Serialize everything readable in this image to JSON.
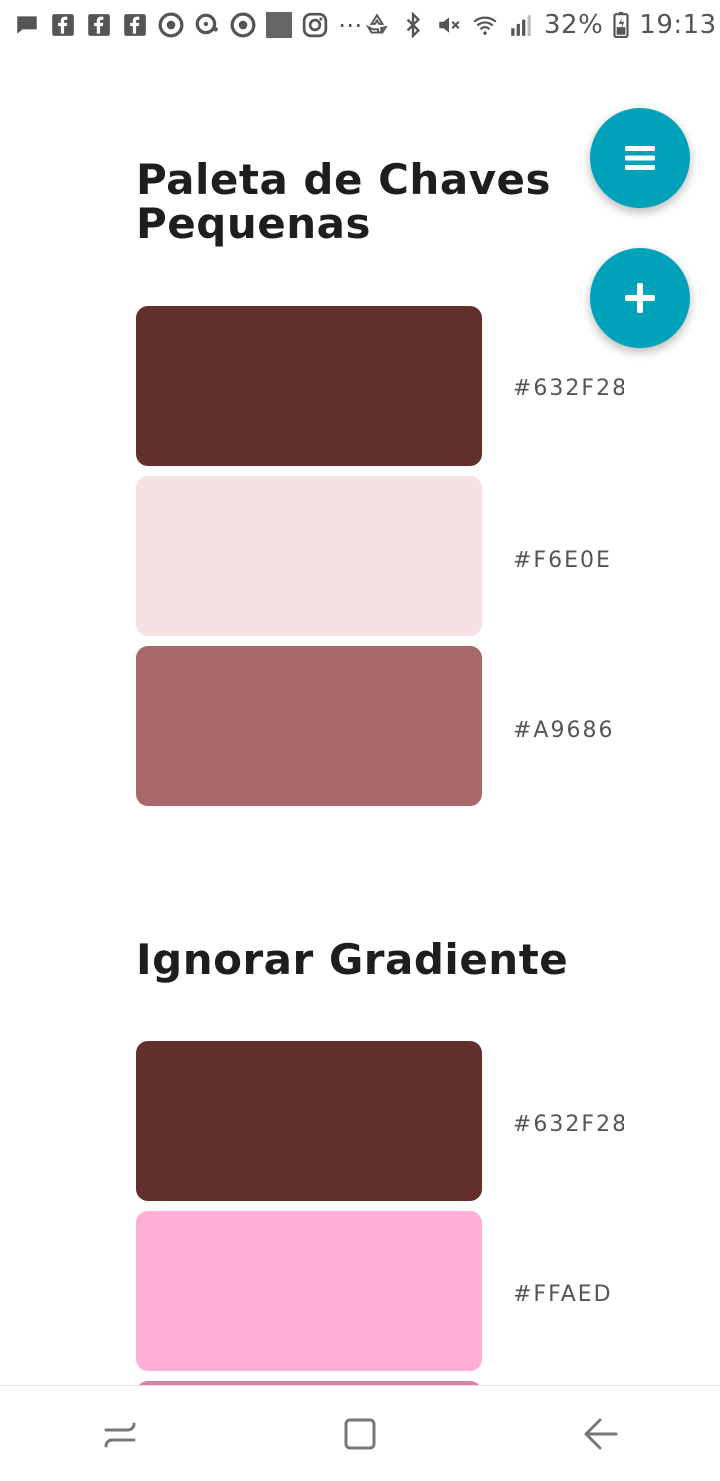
{
  "status_bar": {
    "battery": "32%",
    "time": "19:13",
    "more_dots": "⋯",
    "left_icons": [
      "message-icon",
      "facebook-icon",
      "facebook-icon",
      "facebook-icon",
      "chrome-icon",
      "chat-bubble-icon",
      "chrome-icon",
      "image-icon",
      "instagram-icon"
    ],
    "right_icons": [
      "recycle-icon",
      "bluetooth-icon",
      "mute-icon",
      "wifi-icon",
      "signal-icon",
      "battery-icon"
    ]
  },
  "sections": [
    {
      "title_line1": "Paleta de Chaves",
      "title_line2": "Pequenas",
      "colors": [
        {
          "hex_label": "#632F28",
          "color": "#632F2A"
        },
        {
          "hex_label": "#F6E0E",
          "color": "#F6E0E1"
        },
        {
          "hex_label": "#A9686",
          "color": "#A96868"
        }
      ]
    },
    {
      "title": "Ignorar Gradiente",
      "colors": [
        {
          "hex_label": "#632F28",
          "color": "#632F2A"
        },
        {
          "hex_label": "#FFAED",
          "color": "#FFAED6"
        },
        {
          "hex_label": "",
          "color": "#E07E9E"
        }
      ]
    }
  ],
  "fabs": {
    "menu_icon": "menu-icon",
    "add_icon": "plus-icon",
    "color": "#00A1B9"
  },
  "nav_bar": {
    "icons": [
      "recent-apps-icon",
      "home-icon",
      "back-icon"
    ]
  }
}
